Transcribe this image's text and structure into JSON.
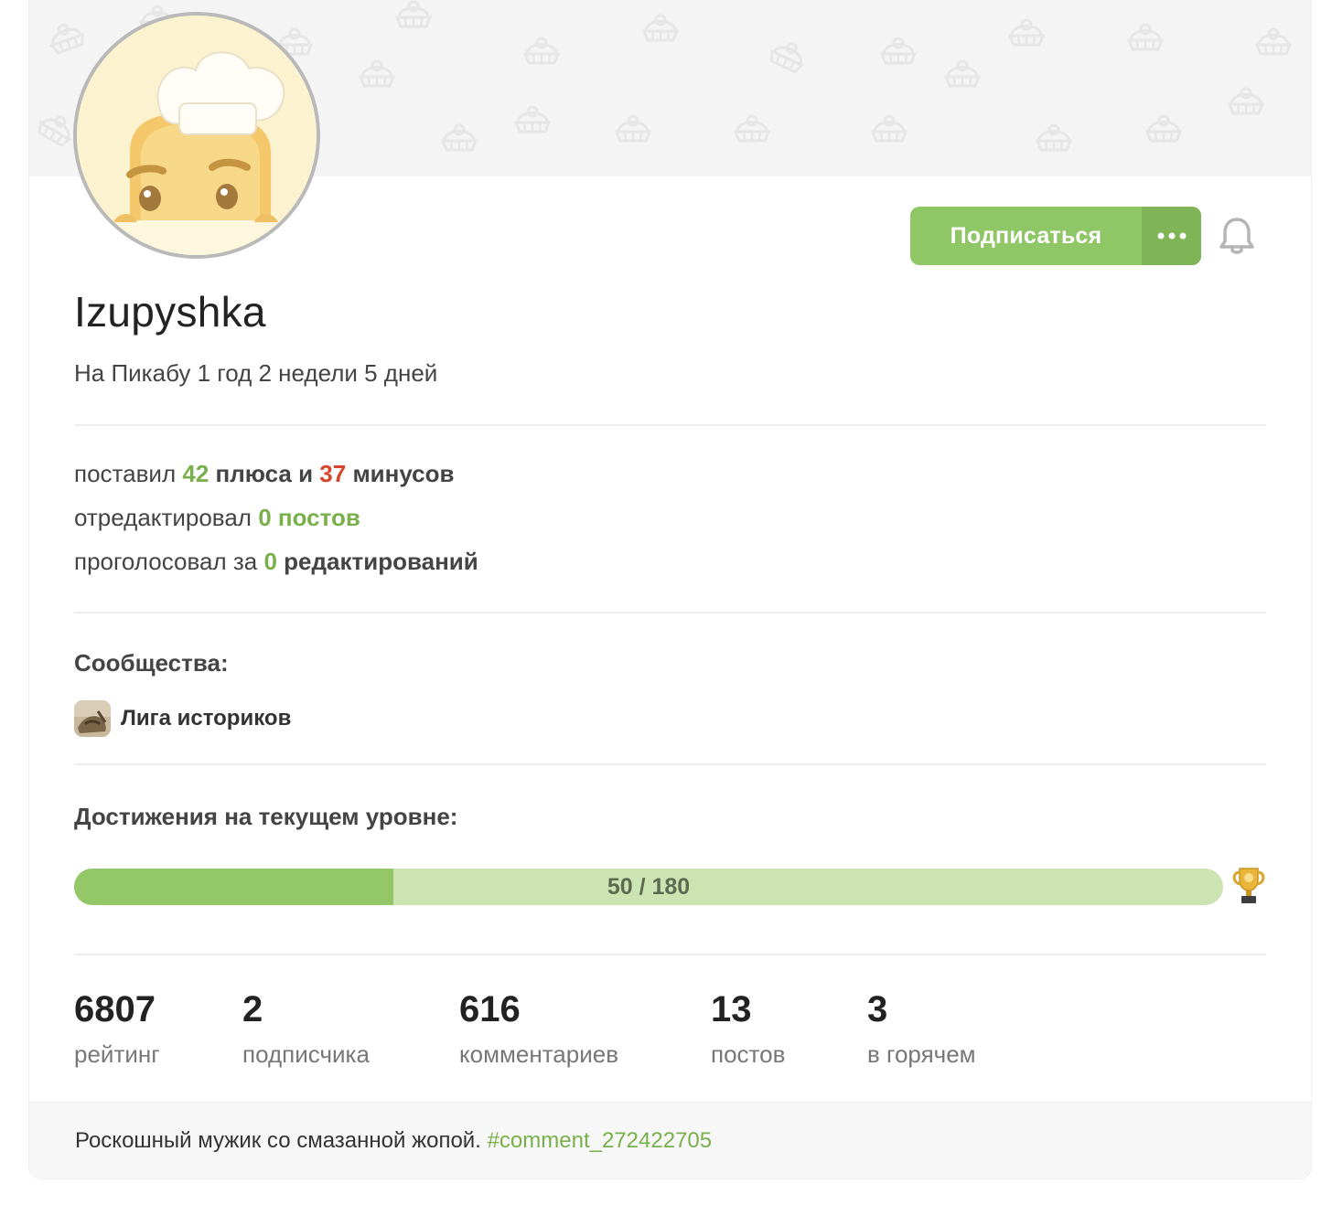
{
  "profile": {
    "username": "Izupyshka",
    "since": "На Пикабу 1 год 2 недели 5 дней"
  },
  "actions": {
    "subscribe_label": "Подписаться",
    "more_icon": "more-horizontal-icon",
    "bell_icon": "bell-icon"
  },
  "activity": {
    "votes_prefix": "поставил",
    "pluses_count": "42",
    "pluses_word": "плюса",
    "and_word": "и",
    "minuses_count": "37",
    "minuses_word": "минусов",
    "edited_prefix": "отредактировал",
    "edited_count": "0",
    "edited_word": "постов",
    "voted_prefix": "проголосовал за",
    "voted_count": "0",
    "voted_word": "редактирований"
  },
  "communities": {
    "title": "Сообщества:",
    "items": [
      {
        "label": "Лига историков"
      }
    ]
  },
  "achievements": {
    "title": "Достижения на текущем уровне:",
    "progress_text": "50 / 180",
    "current": 50,
    "total": 180
  },
  "counters": [
    {
      "value": "6807",
      "label": "рейтинг"
    },
    {
      "value": "2",
      "label": "подписчика"
    },
    {
      "value": "616",
      "label": "комментариев"
    },
    {
      "value": "13",
      "label": "постов"
    },
    {
      "value": "3",
      "label": "в горячем"
    }
  ],
  "footer": {
    "note_text": "Роскошный мужик со смазанной жопой.",
    "note_link": "#comment_272422705"
  },
  "colors": {
    "accent_green": "#8fc666",
    "plus_green": "#79b04b",
    "minus_red": "#d6462d",
    "progress_track": "#cce4b2",
    "progress_fill": "#93c768"
  }
}
